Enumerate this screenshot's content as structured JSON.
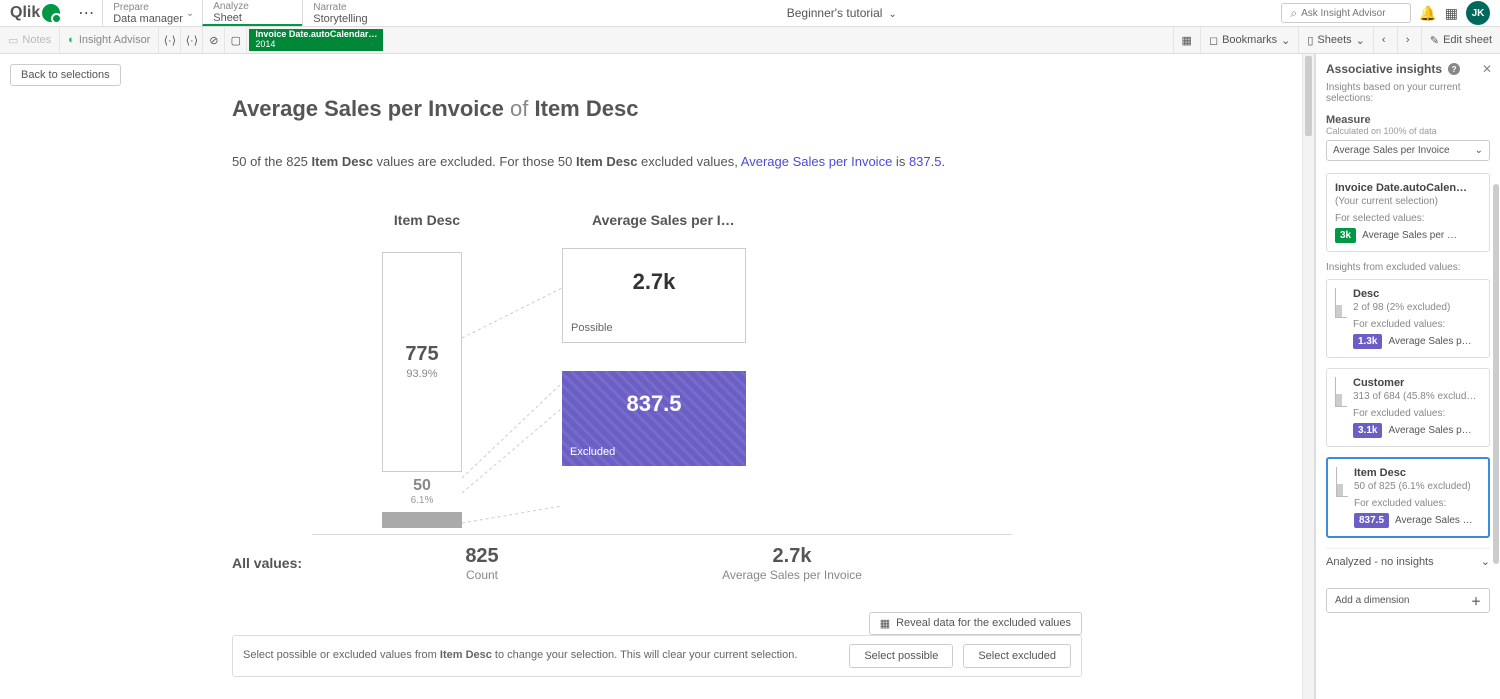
{
  "logo": "Qlik",
  "nav": {
    "prepare": {
      "top": "Prepare",
      "sub": "Data manager"
    },
    "analyze": {
      "top": "Analyze",
      "sub": "Sheet"
    },
    "narrate": {
      "top": "Narrate",
      "sub": "Storytelling"
    }
  },
  "app_title": "Beginner's tutorial",
  "search_placeholder": "Ask Insight Advisor",
  "avatar": "JK",
  "toolbar": {
    "notes": "Notes",
    "insight": "Insight Advisor",
    "selection_line1": "Invoice Date.autoCalendar…",
    "selection_line2": "2014",
    "bookmarks": "Bookmarks",
    "sheets": "Sheets",
    "edit": "Edit sheet"
  },
  "back_btn": "Back to selections",
  "title": {
    "p1": "Average Sales per Invoice",
    "of": "of",
    "p2": "Item Desc"
  },
  "summary": {
    "s1": "50 of the 825 ",
    "s2": "Item Desc",
    "s3": " values are excluded. For those 50 ",
    "s4": "Item Desc",
    "s5": " excluded values, ",
    "s6": "Average Sales per Invoice",
    "s7": " is ",
    "s8": "837.5",
    "s9": "."
  },
  "col1": "Item Desc",
  "col2": "Average Sales per I…",
  "chart_data": {
    "type": "bar",
    "dimension": "Item Desc",
    "measure": "Average Sales per Invoice",
    "possible": {
      "count": 775,
      "pct": "93.9%",
      "avg": "2.7k"
    },
    "excluded": {
      "count": 50,
      "pct": "6.1%",
      "avg": 837.5
    },
    "total": {
      "count": 825,
      "avg": "2.7k"
    }
  },
  "bar": {
    "poss_n": "775",
    "poss_p": "93.9%",
    "exc_n": "50",
    "exc_p": "6.1%"
  },
  "box_possible": {
    "val": "2.7k",
    "lbl": "Possible"
  },
  "box_excluded": {
    "val": "837.5",
    "lbl": "Excluded"
  },
  "allvals": {
    "label": "All values:",
    "count": "825",
    "count_lbl": "Count",
    "avg": "2.7k",
    "avg_lbl": "Average Sales per Invoice"
  },
  "reveal": "Reveal data for the excluded values",
  "bottom": {
    "msg1": "Select possible or excluded values from ",
    "msg2": "Item Desc",
    "msg3": " to change your selection. This will clear your current selection.",
    "b1": "Select possible",
    "b2": "Select excluded"
  },
  "panel": {
    "title": "Associative insights",
    "sub": "Insights based on your current selections:",
    "measure": "Measure",
    "measure_sub": "Calculated on 100% of data",
    "dropdown": "Average Sales per Invoice",
    "card_sel": {
      "t": "Invoice Date.autoCalen…",
      "s": "(Your current selection)",
      "lbl": "For selected values:",
      "chip": "3k",
      "m": "Average Sales per …"
    },
    "exc_header": "Insights from excluded values:",
    "cards": [
      {
        "t": "Desc",
        "s": "2 of 98 (2% excluded)",
        "lbl": "For excluded values:",
        "chip": "1.3k",
        "m": "Average Sales p…"
      },
      {
        "t": "Customer",
        "s": "313 of 684 (45.8% exclud…",
        "lbl": "For excluded values:",
        "chip": "3.1k",
        "m": "Average Sales p…"
      },
      {
        "t": "Item Desc",
        "s": "50 of 825 (6.1% excluded)",
        "lbl": "For excluded values:",
        "chip": "837.5",
        "m": "Average Sales …"
      }
    ],
    "analyzed": "Analyzed - no insights",
    "add": "Add a dimension"
  }
}
